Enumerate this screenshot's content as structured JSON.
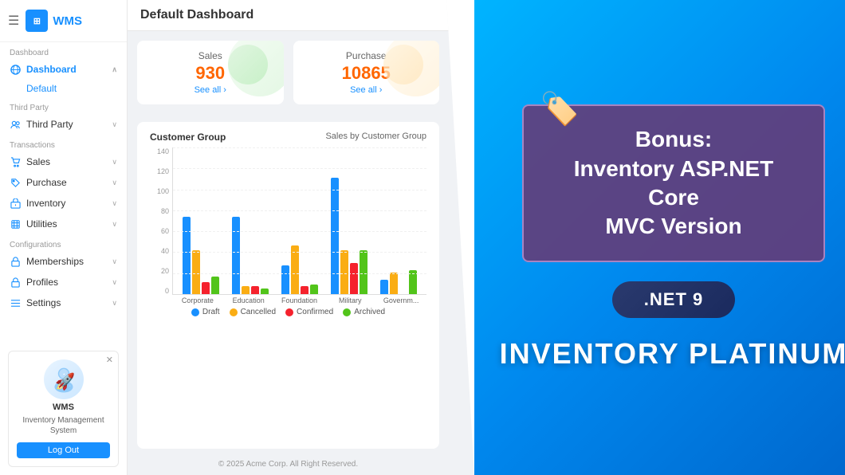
{
  "sidebar": {
    "app_title": "WMS",
    "header_menu": "☰",
    "sections": [
      {
        "label": "Dashboard",
        "items": [
          {
            "id": "dashboard",
            "label": "Dashboard",
            "active": true,
            "icon": "globe"
          },
          {
            "id": "default",
            "label": "Default",
            "sub": true
          }
        ]
      },
      {
        "label": "Third Party",
        "items": [
          {
            "id": "third-party",
            "label": "Third Party",
            "icon": "users",
            "chevron": true
          }
        ]
      },
      {
        "label": "Transactions",
        "items": [
          {
            "id": "sales",
            "label": "Sales",
            "icon": "cart",
            "chevron": true
          },
          {
            "id": "purchase",
            "label": "Purchase",
            "icon": "tag",
            "chevron": true
          },
          {
            "id": "inventory",
            "label": "Inventory",
            "icon": "box",
            "chevron": true
          },
          {
            "id": "utilities",
            "label": "Utilities",
            "icon": "tool",
            "chevron": true
          }
        ]
      },
      {
        "label": "Configurations",
        "items": [
          {
            "id": "memberships",
            "label": "Memberships",
            "icon": "lock",
            "chevron": true
          },
          {
            "id": "profiles",
            "label": "Profiles",
            "icon": "lock",
            "chevron": true
          },
          {
            "id": "settings",
            "label": "Settings",
            "icon": "list",
            "chevron": true
          }
        ]
      }
    ],
    "profile": {
      "name": "WMS",
      "subtitle": "Inventory Management System",
      "logout_label": "Log Out"
    }
  },
  "topbar": {
    "title": "Default Dashboard"
  },
  "stats": [
    {
      "label": "Sales",
      "value": "930",
      "link": "See all ›",
      "color": "#ff6600"
    },
    {
      "label": "Purchase",
      "value": "10865",
      "link": "See all ›",
      "color": "#ff6600"
    }
  ],
  "chart": {
    "section_title": "Customer Group",
    "subtitle": "Sales by Customer Group",
    "y_labels": [
      "0",
      "20",
      "40",
      "60",
      "80",
      "100",
      "120",
      "140"
    ],
    "x_labels": [
      "Corporate",
      "Education",
      "Foundation",
      "Military",
      "Governm..."
    ],
    "legend": [
      {
        "label": "Draft",
        "color": "#1890ff"
      },
      {
        "label": "Cancelled",
        "color": "#faad14"
      },
      {
        "label": "Confirmed",
        "color": "#f5222d"
      },
      {
        "label": "Archived",
        "color": "#52c41a"
      }
    ],
    "groups": [
      {
        "name": "Corporate",
        "bars": [
          80,
          45,
          12,
          18
        ]
      },
      {
        "name": "Education",
        "bars": [
          80,
          8,
          8,
          6
        ]
      },
      {
        "name": "Foundation",
        "bars": [
          30,
          50,
          8,
          10
        ]
      },
      {
        "name": "Military",
        "bars": [
          120,
          45,
          32,
          45
        ]
      },
      {
        "name": "Government",
        "bars": [
          15,
          22,
          0,
          25
        ]
      }
    ]
  },
  "footer": {
    "text": "© 2025 Acme Corp. All Right Reserved."
  },
  "promo": {
    "tag_icon": "🏷️",
    "bonus_title": "Bonus:\nInventory ASP.NET Core\nMVC Version",
    "dotnet_label": ".NET 9",
    "main_title": "INVENTORY PLATINUM"
  }
}
